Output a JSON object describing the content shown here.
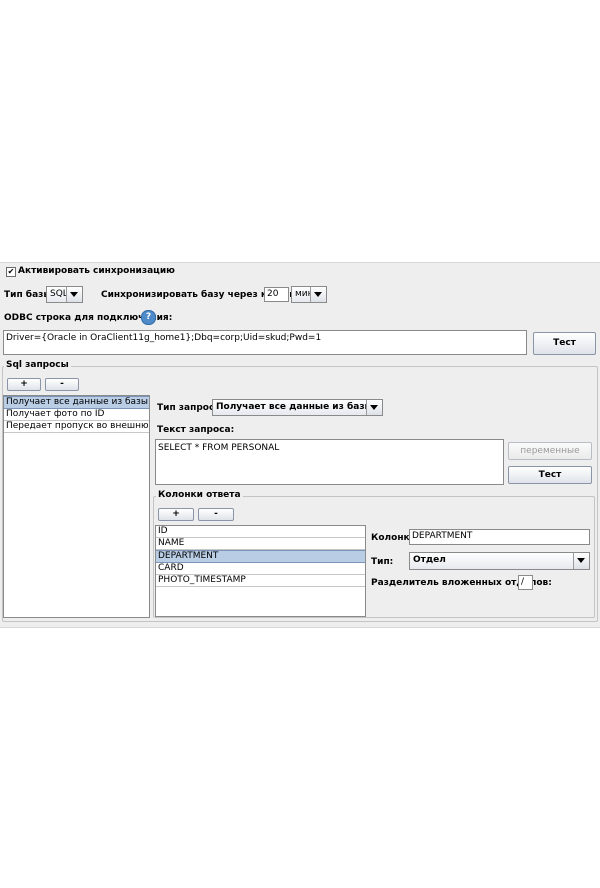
{
  "sync": {
    "activate_label": "Активировать синхронизацию",
    "activate_checked": true,
    "db_type_label": "Тип базы:",
    "db_type_value": "SQL",
    "interval_label": "Синхронизировать базу через каждые",
    "interval_value": "20",
    "interval_unit": "мин",
    "odbc_label": "ODBC строка для подключения:",
    "odbc_value": "Driver={Oracle in OraClient11g_home1};Dbq=corp;Uid=skud;Pwd=1",
    "test_button": "Тест"
  },
  "sql_group": {
    "title": "Sql запросы",
    "add_button": "+",
    "remove_button": "-",
    "queries": [
      {
        "label": "Получает все данные из базы",
        "selected": true
      },
      {
        "label": "Получает фото по ID",
        "selected": false
      },
      {
        "label": "Передает пропуск во внешнюю базу",
        "selected": false
      }
    ],
    "query_type_label": "Тип запроса:",
    "query_type_value": "Получает все данные из базы",
    "query_text_label": "Текст запроса:",
    "query_text_value": "SELECT * FROM PERSONAL",
    "variables_button": "переменные",
    "test_button": "Тест"
  },
  "columns_group": {
    "title": "Колонки ответа",
    "add_button": "+",
    "remove_button": "-",
    "columns": [
      {
        "label": "ID",
        "selected": false
      },
      {
        "label": "NAME",
        "selected": false
      },
      {
        "label": "DEPARTMENT",
        "selected": true
      },
      {
        "label": "CARD",
        "selected": false
      },
      {
        "label": "PHOTO_TIMESTAMP",
        "selected": false
      }
    ],
    "column_label": "Колонка:",
    "column_value": "DEPARTMENT",
    "type_label": "Тип:",
    "type_value": "Отдел",
    "separator_label": "Разделитель вложенных отделов:",
    "separator_value": "/"
  },
  "icons": {
    "help": "help-icon",
    "checkbox": "checkmark-icon",
    "dropdown": "chevron-down-icon"
  }
}
